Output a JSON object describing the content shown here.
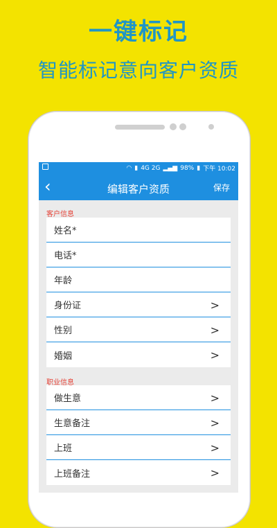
{
  "promo": {
    "title": "一键标记",
    "subtitle": "智能标记意向客户资质"
  },
  "status_bar": {
    "battery": "98%",
    "time": "下午 10:02",
    "signal": "4G 2G"
  },
  "app_bar": {
    "title": "编辑客户资质",
    "save_label": "保存"
  },
  "customer_section": {
    "label": "客户信息",
    "rows": [
      {
        "label": "姓名*",
        "has_chevron": false
      },
      {
        "label": "电话*",
        "has_chevron": false
      },
      {
        "label": "年龄",
        "has_chevron": false
      },
      {
        "label": "身份证",
        "has_chevron": true
      },
      {
        "label": "性别",
        "has_chevron": true
      },
      {
        "label": "婚姻",
        "has_chevron": true
      }
    ]
  },
  "job_section": {
    "label": "职业信息",
    "rows": [
      {
        "label": "做生意",
        "has_chevron": true
      },
      {
        "label": "生意备注",
        "has_chevron": true
      },
      {
        "label": "上班",
        "has_chevron": true
      },
      {
        "label": "上班备注",
        "has_chevron": true
      }
    ]
  },
  "colors": {
    "background": "#f3e300",
    "accent": "#1e8fe0",
    "promo_text": "#1f95c6",
    "section_label": "#e6453a"
  }
}
